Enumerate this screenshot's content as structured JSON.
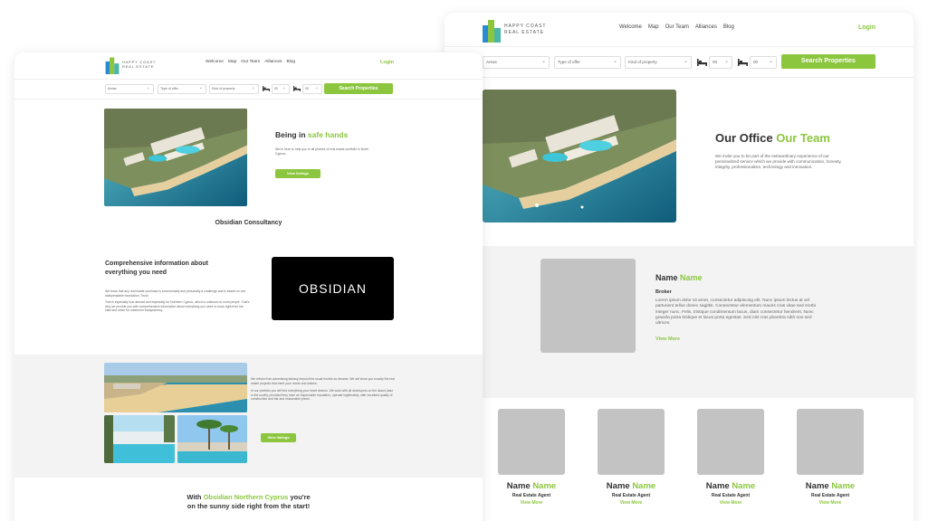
{
  "brand": {
    "logo_line1": "HAPPY COAST",
    "logo_line2": "REAL ESTATE",
    "accent": "#8cc63f",
    "text_dark": "#333333",
    "placeholder_gray": "#c3c3c3",
    "section_gray": "#f3f3f3"
  },
  "nav": {
    "items": [
      "Welcome",
      "Map",
      "Our Team",
      "Alliances",
      "Blog"
    ],
    "login": "Login"
  },
  "search": {
    "areas": "Areas",
    "type_of_offer": "Type of offer",
    "kind_of_property": "Kind of property",
    "bedrooms": "00",
    "bathrooms": "00",
    "bed_icon": "bed-icon",
    "bath_icon": "bath-icon",
    "button": "Search Properties"
  },
  "back_page": {
    "hero_title_a": "Our Office",
    "hero_title_b": "Our Team",
    "hero_text": "We invite you to be part of the extraordinary experience of our personalized service which we provide with communication, honesty, integrity, professionalism, technology and innovation.",
    "profile": {
      "name_a": "Name",
      "name_b": "Name",
      "role": "Broker",
      "text": "Lorem ipsum dolor sit amet, consectetur adipiscing elit. Nunc ipsum lectus at vel parturient tellus donec sagittis. Consectetur elementum mauris cras vitae sed morbi integer nunc. Felis, tristique condimentum lacus, diam consectetur hendrerit. Nunc gravida porta tristique et lacus porta egestas. Sed nisl cras pharetra nibh non sed ultrices.",
      "view_more": "View More"
    },
    "agents": [
      {
        "name_a": "Name",
        "name_b": "Name",
        "role": "Real Estate Agent",
        "view_more": "View More"
      },
      {
        "name_a": "Name",
        "name_b": "Name",
        "role": "Real Estate Agent",
        "view_more": "View More"
      },
      {
        "name_a": "Name",
        "name_b": "Name",
        "role": "Real Estate Agent",
        "view_more": "View More"
      },
      {
        "name_a": "Name",
        "name_b": "Name",
        "role": "Real Estate Agent",
        "view_more": "View More"
      }
    ]
  },
  "front_page": {
    "hero_title_a": "Being in",
    "hero_title_b": "safe hands",
    "hero_text": "We're here to help you in all phases of real estate portfolio in North Cyprus.",
    "hero_button": "View listings",
    "consultancy": "Obsidian Consultancy",
    "info_title": "Comprehensive information about everything you need",
    "info_p1": "We know that any real estate purchase is economically and personally a challenge and is based on one indispensable foundation: Trust!",
    "info_p2": "This is especially true abroad and especially for Northern Cyprus, which is unknown to most people. That's why we provide you with comprehensive information about everything you need to know right from the start and strive for maximum transparency.",
    "obsidian_logo": "OBSIDIAN",
    "gray_p1": "We refrain from advertising fantasy beyond the usual trouble as dreams. We will show you exactly the real estate projects that meet your needs and wishes.",
    "gray_p2": "In our portfolio you will find everything your heart desires. We work with all developers on the island (also in the south), provided they have an impeccable reputation, operate legitimately, offer excellent quality of construction and fair and reasonable prices.",
    "gray_button": "View listings",
    "bottom_a": "With",
    "bottom_g": "Obsidian Northern Cyprus",
    "bottom_b": "you're",
    "bottom_line2": "on the sunny side right from the start!"
  }
}
